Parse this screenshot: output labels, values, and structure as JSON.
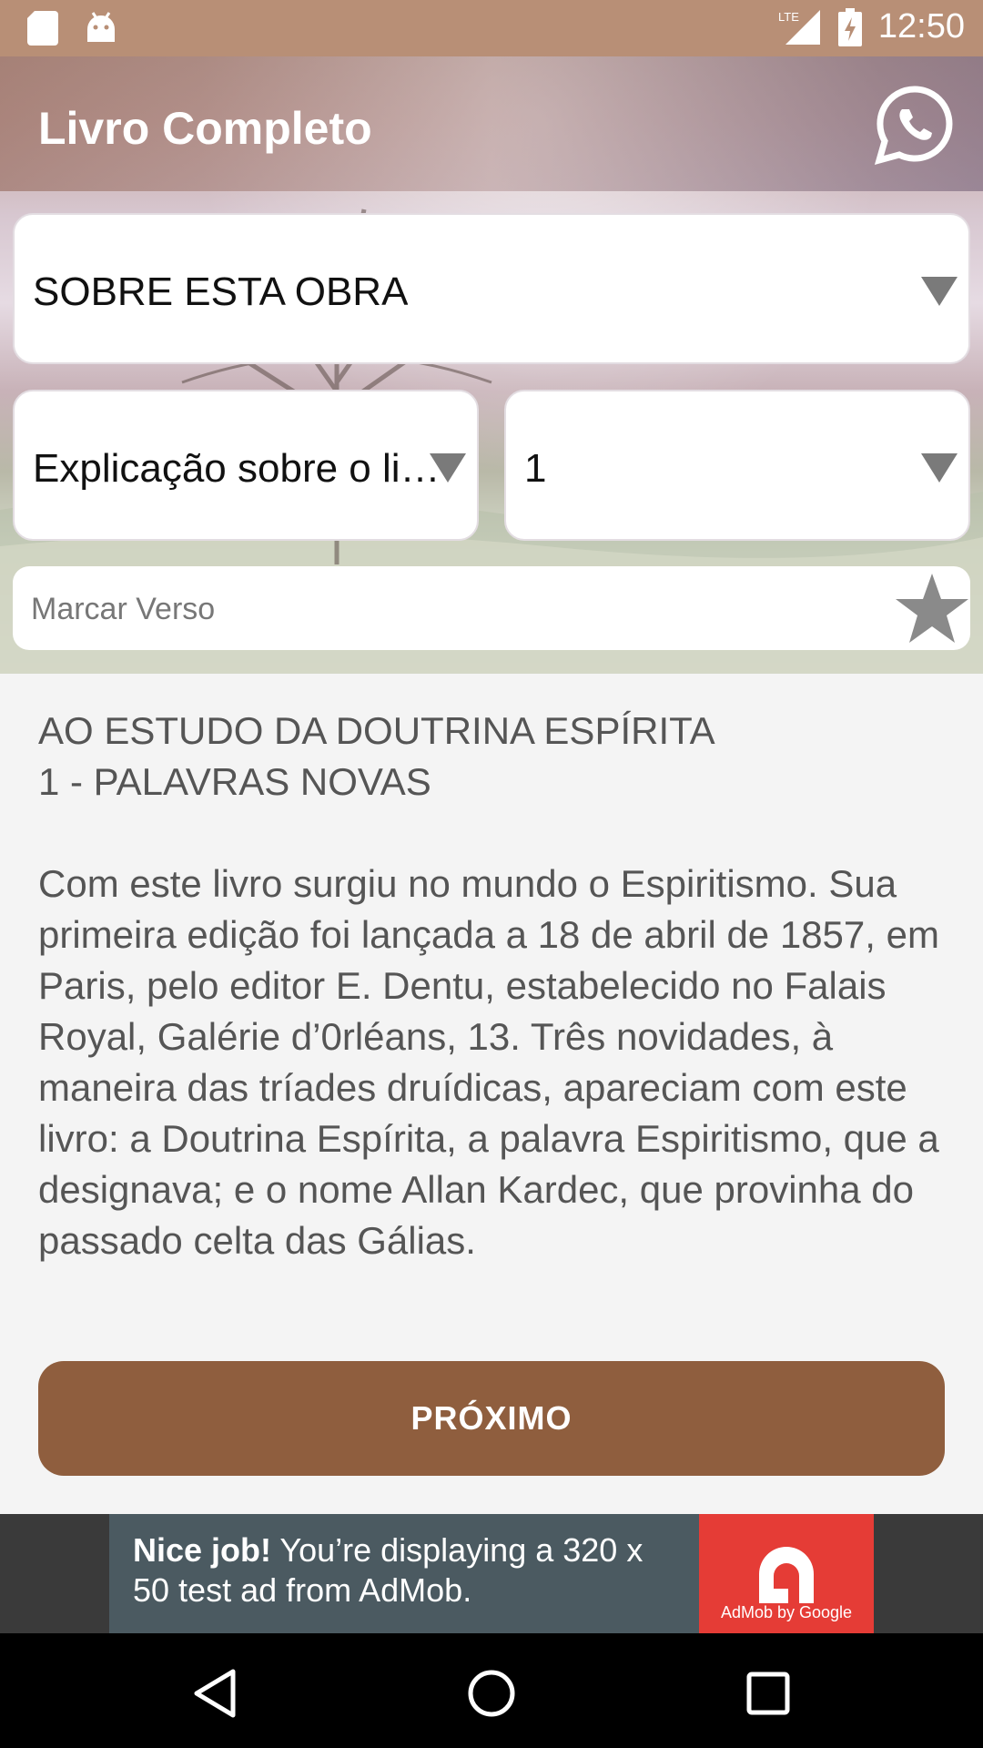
{
  "status_bar": {
    "time": "12:50",
    "network": "LTE",
    "icons": [
      "sd-card-icon",
      "android-icon",
      "signal-icon",
      "battery-charging-icon"
    ]
  },
  "app_bar": {
    "title": "Livro Completo",
    "action_icon": "whatsapp-icon"
  },
  "selectors": {
    "section": "SOBRE ESTA OBRA",
    "chapter": "Explicação sobre o livro",
    "verse": "1"
  },
  "bookmark": {
    "placeholder": "Marcar Verso",
    "icon": "star-icon"
  },
  "content": {
    "heading_line1": "AO ESTUDO DA DOUTRINA ESPÍRITA",
    "heading_line2": "1 - PALAVRAS NOVAS",
    "body": "Com este livro surgiu no mundo o Espiritismo. Sua primeira edição foi lançada a 18 de abril de 1857, em Paris, pelo editor E. Dentu, estabelecido no Falais Royal, Galérie d’0rléans, 13. Três novidades, à maneira das tríades druídicas, apareciam com este livro: a Doutrina Espírita, a palavra Espiritismo, que a designava; e o nome Allan Kardec, que provinha do passado celta das Gálias."
  },
  "next_button": {
    "label": "PRÓXIMO"
  },
  "ad": {
    "bold": "Nice job!",
    "text": " You’re displaying a 320 x 50 test ad from AdMob.",
    "logo_caption": "AdMob by Google"
  },
  "nav_bar": {
    "buttons": [
      "back-icon",
      "home-icon",
      "recents-icon"
    ]
  },
  "colors": {
    "status_bar": "#b88f76",
    "button": "#8f5e3e",
    "ad_red": "#e53c36"
  }
}
